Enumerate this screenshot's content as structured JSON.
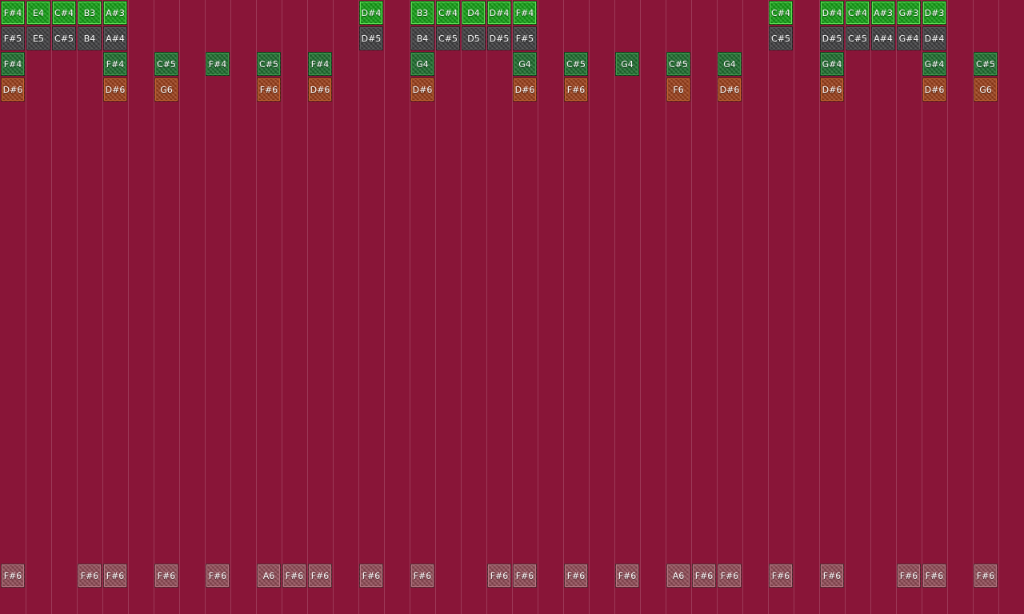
{
  "colors": {
    "background": "#891538",
    "bright_green": "#129e13",
    "dark_gray": "#3d3d3f",
    "mid_green": "#1d6b2d",
    "orange": "#9a3e18",
    "pink": "#8f4a55"
  },
  "rows": [
    {
      "kind": "t-bright",
      "cells": [
        {
          "col": 0,
          "label": "F#4"
        },
        {
          "col": 1,
          "label": "E4"
        },
        {
          "col": 2,
          "label": "C#4"
        },
        {
          "col": 3,
          "label": "B3"
        },
        {
          "col": 4,
          "label": "A#3"
        },
        {
          "col": 14,
          "label": "D#4"
        },
        {
          "col": 16,
          "label": "B3"
        },
        {
          "col": 17,
          "label": "C#4"
        },
        {
          "col": 18,
          "label": "D4"
        },
        {
          "col": 19,
          "label": "D#4"
        },
        {
          "col": 20,
          "label": "F#4"
        },
        {
          "col": 30,
          "label": "C#4"
        },
        {
          "col": 32,
          "label": "D#4"
        },
        {
          "col": 33,
          "label": "C#4"
        },
        {
          "col": 34,
          "label": "A#3"
        },
        {
          "col": 35,
          "label": "G#3"
        },
        {
          "col": 36,
          "label": "D#3"
        }
      ]
    },
    {
      "kind": "t-dark",
      "cells": [
        {
          "col": 0,
          "label": "F#5"
        },
        {
          "col": 1,
          "label": "E5"
        },
        {
          "col": 2,
          "label": "C#5"
        },
        {
          "col": 3,
          "label": "B4"
        },
        {
          "col": 4,
          "label": "A#4"
        },
        {
          "col": 14,
          "label": "D#5"
        },
        {
          "col": 16,
          "label": "B4"
        },
        {
          "col": 17,
          "label": "C#5"
        },
        {
          "col": 18,
          "label": "D5"
        },
        {
          "col": 19,
          "label": "D#5"
        },
        {
          "col": 20,
          "label": "F#5"
        },
        {
          "col": 30,
          "label": "C#5"
        },
        {
          "col": 32,
          "label": "D#5"
        },
        {
          "col": 33,
          "label": "C#5"
        },
        {
          "col": 34,
          "label": "A#4"
        },
        {
          "col": 35,
          "label": "G#4"
        },
        {
          "col": 36,
          "label": "D#4"
        }
      ]
    },
    {
      "kind": "t-mid",
      "cells": [
        {
          "col": 0,
          "label": "F#4"
        },
        {
          "col": 4,
          "label": "F#4"
        },
        {
          "col": 6,
          "label": "C#5"
        },
        {
          "col": 8,
          "label": "F#4"
        },
        {
          "col": 10,
          "label": "C#5"
        },
        {
          "col": 12,
          "label": "F#4"
        },
        {
          "col": 16,
          "label": "G4"
        },
        {
          "col": 20,
          "label": "G4"
        },
        {
          "col": 22,
          "label": "C#5"
        },
        {
          "col": 24,
          "label": "G4"
        },
        {
          "col": 26,
          "label": "C#5"
        },
        {
          "col": 28,
          "label": "G4"
        },
        {
          "col": 32,
          "label": "G#4"
        },
        {
          "col": 36,
          "label": "G#4"
        },
        {
          "col": 38,
          "label": "C#5"
        }
      ]
    },
    {
      "kind": "t-orange",
      "cells": [
        {
          "col": 0,
          "label": "D#6"
        },
        {
          "col": 4,
          "label": "D#6"
        },
        {
          "col": 6,
          "label": "G6"
        },
        {
          "col": 10,
          "label": "F#6"
        },
        {
          "col": 12,
          "label": "D#6"
        },
        {
          "col": 16,
          "label": "D#6"
        },
        {
          "col": 20,
          "label": "D#6"
        },
        {
          "col": 22,
          "label": "F#6"
        },
        {
          "col": 26,
          "label": "F6"
        },
        {
          "col": 28,
          "label": "D#6"
        },
        {
          "col": 32,
          "label": "D#6"
        },
        {
          "col": 36,
          "label": "D#6"
        },
        {
          "col": 38,
          "label": "G6"
        }
      ]
    },
    {
      "kind": "t-pink",
      "cells": [
        {
          "col": 0,
          "label": "F#6"
        },
        {
          "col": 3,
          "label": "F#6"
        },
        {
          "col": 4,
          "label": "F#6"
        },
        {
          "col": 6,
          "label": "F#6"
        },
        {
          "col": 8,
          "label": "F#6"
        },
        {
          "col": 10,
          "label": "A6"
        },
        {
          "col": 11,
          "label": "F#6"
        },
        {
          "col": 12,
          "label": "F#6"
        },
        {
          "col": 14,
          "label": "F#6"
        },
        {
          "col": 16,
          "label": "F#6"
        },
        {
          "col": 19,
          "label": "F#6"
        },
        {
          "col": 20,
          "label": "F#6"
        },
        {
          "col": 22,
          "label": "F#6"
        },
        {
          "col": 24,
          "label": "F#6"
        },
        {
          "col": 26,
          "label": "A6"
        },
        {
          "col": 27,
          "label": "F#6"
        },
        {
          "col": 28,
          "label": "F#6"
        },
        {
          "col": 30,
          "label": "F#6"
        },
        {
          "col": 32,
          "label": "F#6"
        },
        {
          "col": 35,
          "label": "F#6"
        },
        {
          "col": 36,
          "label": "F#6"
        },
        {
          "col": 38,
          "label": "F#6"
        }
      ]
    }
  ]
}
